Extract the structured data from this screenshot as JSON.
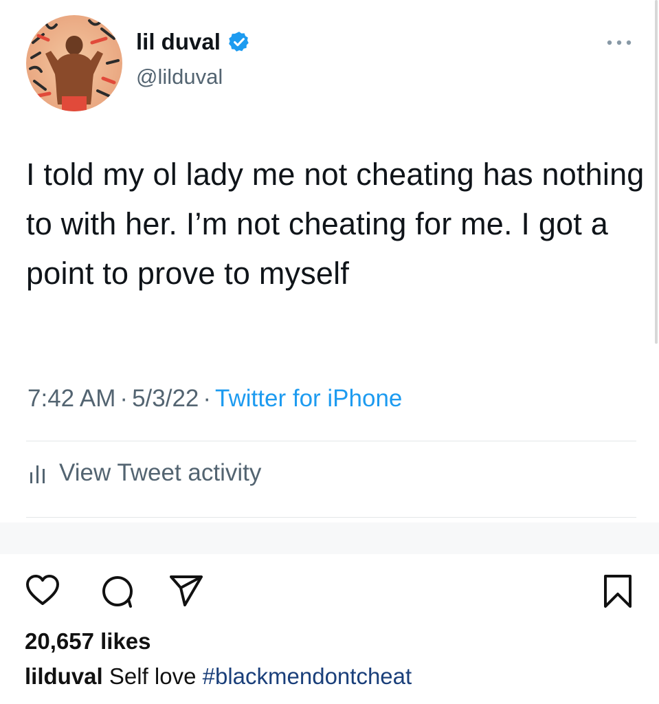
{
  "tweet": {
    "display_name": "lil duval",
    "handle": "@lilduval",
    "text": "I told my ol lady me not cheating has nothing to with her. I’m not cheating for me. I got a point to prove to myself",
    "time": "7:42 AM",
    "date": "5/3/22",
    "separator": "·",
    "source": "Twitter for iPhone",
    "activity_label": "View Tweet activity",
    "icons": {
      "avatar": "profile-avatar",
      "verified": "verified-badge-icon",
      "more": "more-options-icon",
      "activity": "bar-chart-icon"
    },
    "colors": {
      "link": "#1d9bf0",
      "secondary": "#536471",
      "verified": "#1d9bf0"
    }
  },
  "instagram": {
    "likes": "20,657 likes",
    "caption_user": "lilduval",
    "caption_text": "Self love",
    "caption_tag": "#blackmendontcheat",
    "icons": [
      "heart-icon",
      "comment-icon",
      "share-icon",
      "bookmark-icon"
    ]
  }
}
